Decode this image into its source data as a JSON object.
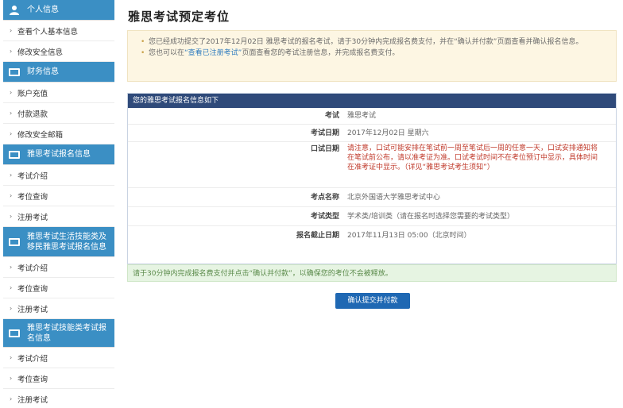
{
  "sidebar": {
    "sections": [
      {
        "title": "个人信息",
        "items": [
          "查看个人基本信息",
          "修改安全信息"
        ]
      },
      {
        "title": "财务信息",
        "items": [
          "账户充值",
          "付款退款",
          "修改安全邮箱"
        ]
      },
      {
        "title": "雅思考试报名信息",
        "items": [
          "考试介绍",
          "考位查询",
          "注册考试"
        ]
      },
      {
        "title": "雅思考试生活技能类及移民雅思考试报名信息",
        "items": [
          "考试介绍",
          "考位查询",
          "注册考试"
        ]
      },
      {
        "title": "雅思考试技能类考试报名信息",
        "items": [
          "考试介绍",
          "考位查询",
          "注册考试"
        ]
      }
    ]
  },
  "main": {
    "title": "雅思考试预定考位",
    "notice": {
      "line1_a": "您已经成功提交了2017年12月02日 雅思考试的报名考试，请于30分钟内完成报名费支付，并在“确认并付款”页面",
      "line1_b": "查看并确认报名信息。",
      "line2_a": "您也可以在",
      "line2_link": "“查看已注册考试”",
      "line2_b": "页面查看您的考试注册信息，并完成报名费支付。"
    },
    "panel": {
      "heading": "您的雅思考试报名信息如下",
      "rows": [
        {
          "label": "考试",
          "value": "雅思考试"
        },
        {
          "label": "考试日期",
          "value": "2017年12月02日 星期六"
        },
        {
          "label": "口试日期",
          "value": "请注意，口试可能安排在笔试前一周至笔试后一周的任意一天，口试安排通知将在笔试前公布，请以准考证为准。口试考试时间不在考位预订中显示，具体时间在准考证中显示。（详见“雅思考试考生须知”）"
        },
        {
          "label": "考点名称",
          "value": "北京外国语大学雅思考试中心"
        },
        {
          "label": "考试类型",
          "value": "学术类/培训类（请在报名时选择您需要的考试类型）"
        },
        {
          "label": "报名截止日期",
          "value": "2017年11月13日 05:00（北京时间）"
        }
      ]
    },
    "success_message": "请于30分钟内完成报名费支付并点击“确认并付款”，以确保您的考位不会被释放。",
    "submit_label": "确认提交并付款"
  }
}
